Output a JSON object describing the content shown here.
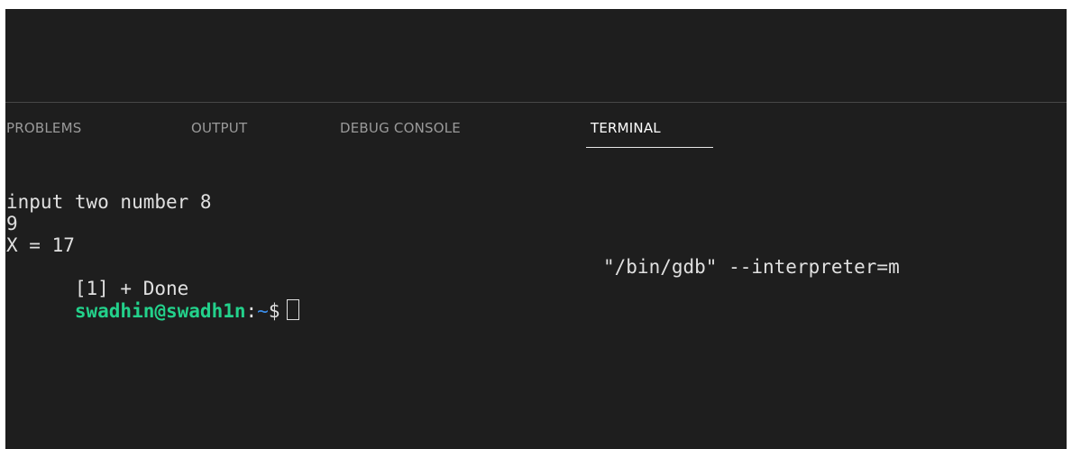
{
  "panel": {
    "tabs": [
      {
        "label": "PROBLEMS"
      },
      {
        "label": "OUTPUT"
      },
      {
        "label": "DEBUG CONSOLE"
      },
      {
        "label": "TERMINAL"
      }
    ],
    "active_tab": "TERMINAL"
  },
  "terminal": {
    "lines": [
      "input two number 8",
      "9",
      "X = 17",
      "[1] + Done"
    ],
    "done_command": "\"/bin/gdb\" --interpreter=m",
    "prompt": {
      "user_host": "swadhin@swadh1n",
      "colon": ":",
      "path": "~",
      "dollar": "$"
    }
  },
  "colors": {
    "background": "#1e1e1e",
    "prompt_user": "#23d18b",
    "prompt_path": "#3b8eea",
    "active_tab": "#ffffff",
    "inactive_tab": "#9a9a9a"
  }
}
